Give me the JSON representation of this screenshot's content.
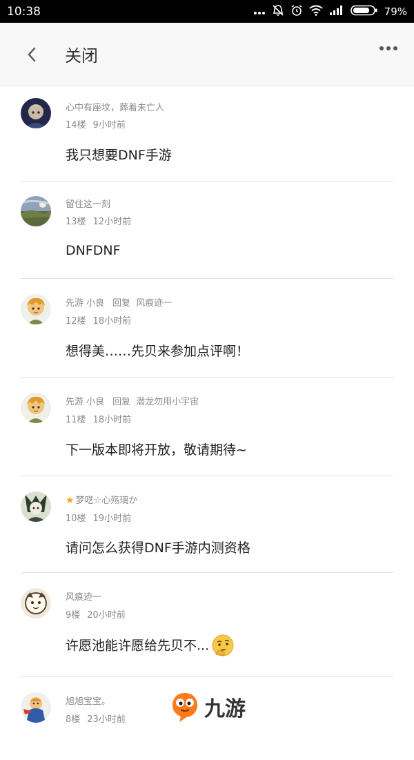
{
  "status_bar": {
    "time": "10:38",
    "battery": "79%"
  },
  "header": {
    "title": "关闭"
  },
  "comments": [
    {
      "name": "心中有座坟，葬着未亡人",
      "floor": "14楼",
      "time": "9小时前",
      "text": "我只想要DNF手游"
    },
    {
      "name": "留住这一刻",
      "floor": "13楼",
      "time": "12小时前",
      "text": "DNFDNF"
    },
    {
      "name": "先游 小良",
      "reply_label": "回复",
      "reply_to": "风痕迹一",
      "floor": "12楼",
      "time": "18小时前",
      "text": "想得美……先贝来参加点评啊！"
    },
    {
      "name": "先游 小良",
      "reply_label": "回复",
      "reply_to": "潜龙勿用小宇宙",
      "floor": "11楼",
      "time": "18小时前",
      "text": "下一版本即将开放，敬请期待~"
    },
    {
      "name": "梦呓☆心殇璃か",
      "floor": "10楼",
      "time": "19小时前",
      "text": "请问怎么获得DNF手游内测资格"
    },
    {
      "name": "风痕迹一",
      "floor": "9楼",
      "time": "20小时前",
      "text": "许愿池能许愿给先贝不..."
    },
    {
      "name": "旭旭宝宝。",
      "floor": "8楼",
      "time": "23小时前",
      "text": ""
    }
  ],
  "watermark": {
    "text": "九游"
  },
  "colors": {
    "status_bar_bg": "#000000",
    "appbar_bg": "#f8f8f8",
    "meta_text": "#8a8a8a",
    "divider": "#e0e0e0"
  }
}
